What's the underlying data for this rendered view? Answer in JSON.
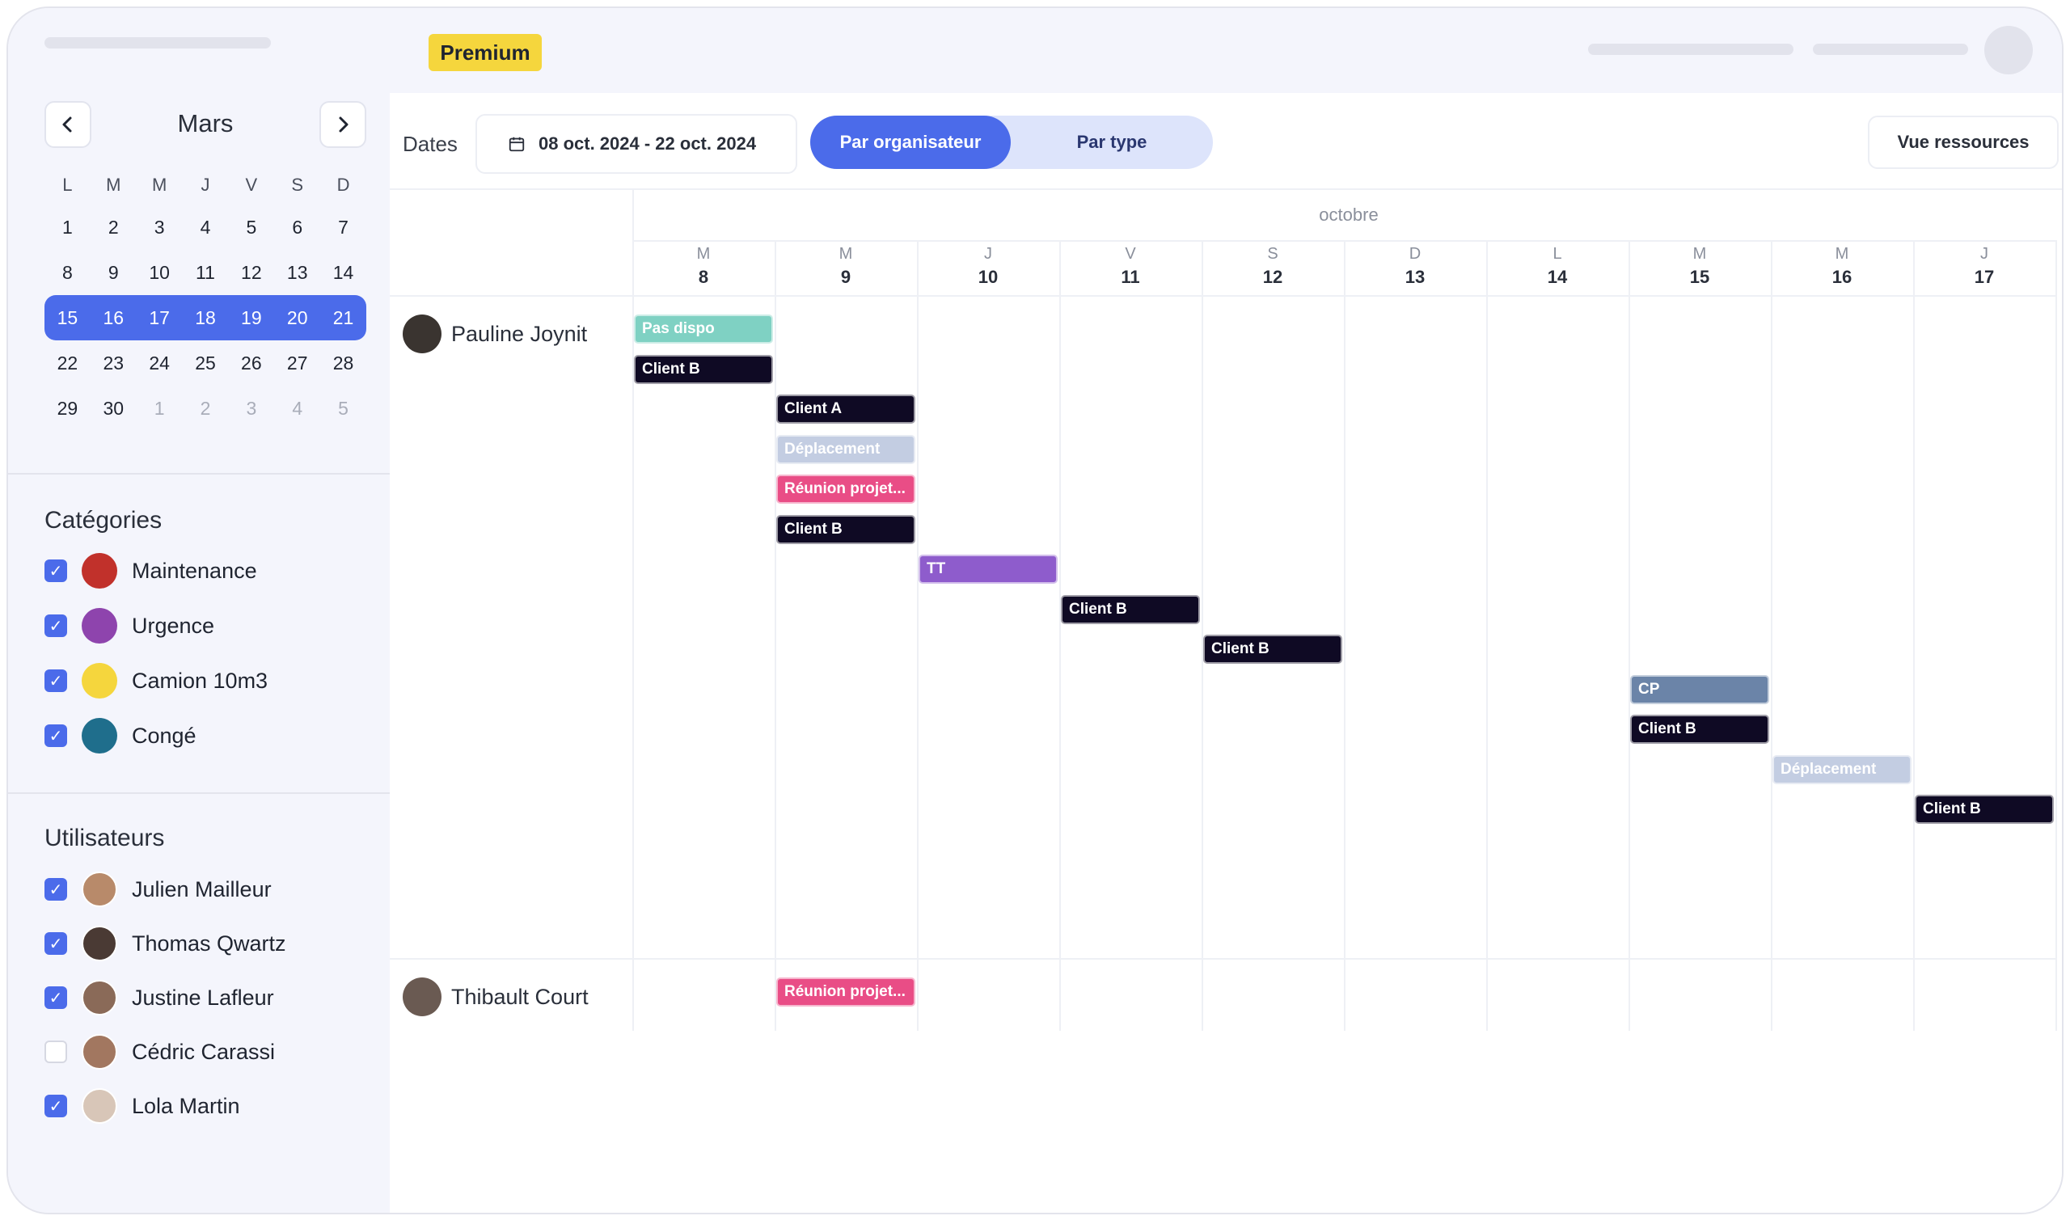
{
  "header": {
    "badge": "Premium"
  },
  "calendar": {
    "month": "Mars",
    "prev_icon": "chevron-left-icon",
    "next_icon": "chevron-right-icon",
    "weekdays": [
      "L",
      "M",
      "M",
      "J",
      "V",
      "S",
      "D"
    ],
    "weeks": [
      [
        "1",
        "2",
        "3",
        "4",
        "5",
        "6",
        "7"
      ],
      [
        "8",
        "9",
        "10",
        "11",
        "12",
        "13",
        "14"
      ],
      [
        "15",
        "16",
        "17",
        "18",
        "19",
        "20",
        "21"
      ],
      [
        "22",
        "23",
        "24",
        "25",
        "26",
        "27",
        "28"
      ],
      [
        "29",
        "30",
        "1",
        "2",
        "3",
        "4",
        "5"
      ]
    ],
    "selected_week": 2
  },
  "categories": {
    "title": "Catégories",
    "items": [
      {
        "label": "Maintenance",
        "color": "#c1312b",
        "checked": true
      },
      {
        "label": "Urgence",
        "color": "#8e44ad",
        "checked": true
      },
      {
        "label": "Camion 10m3",
        "color": "#f5d63d",
        "checked": true
      },
      {
        "label": "Congé",
        "color": "#1f6e8c",
        "checked": true
      }
    ]
  },
  "users": {
    "title": "Utilisateurs",
    "items": [
      {
        "label": "Julien Mailleur",
        "checked": true,
        "avatar_color": "#b88a6a"
      },
      {
        "label": "Thomas Qwartz",
        "checked": true,
        "avatar_color": "#4a3a34"
      },
      {
        "label": "Justine Lafleur",
        "checked": true,
        "avatar_color": "#8a6a58"
      },
      {
        "label": "Cédric Carassi",
        "checked": false,
        "avatar_color": "#a27760"
      },
      {
        "label": "Lola Martin",
        "checked": true,
        "avatar_color": "#d8c6b8"
      }
    ]
  },
  "toolbar": {
    "dates_label": "Dates",
    "date_range": "08 oct. 2024 - 22 oct. 2024",
    "seg_active": "Par organisateur",
    "seg_inactive": "Par type",
    "resources_button": "Vue ressources"
  },
  "planner": {
    "month": "octobre",
    "days": [
      {
        "letter": "M",
        "num": "8"
      },
      {
        "letter": "M",
        "num": "9"
      },
      {
        "letter": "J",
        "num": "10"
      },
      {
        "letter": "V",
        "num": "11"
      },
      {
        "letter": "S",
        "num": "12"
      },
      {
        "letter": "D",
        "num": "13"
      },
      {
        "letter": "L",
        "num": "14"
      },
      {
        "letter": "M",
        "num": "15"
      },
      {
        "letter": "M",
        "num": "16"
      },
      {
        "letter": "J",
        "num": "17"
      }
    ],
    "rows": [
      {
        "name": "Pauline Joynit",
        "avatar_color": "#3a3430",
        "events": [
          {
            "label": "Pas dispo",
            "day": 0,
            "span": 1,
            "color": "#7fd1c3"
          },
          {
            "label": "Client B",
            "day": 0,
            "span": 1,
            "color": "#0f0a24"
          },
          {
            "label": "Client A",
            "day": 1,
            "span": 1,
            "color": "#0f0a24"
          },
          {
            "label": "Déplacement",
            "day": 1,
            "span": 1,
            "color": "#c3cde2"
          },
          {
            "label": "Réunion projet...",
            "day": 1,
            "span": 1,
            "color": "#e94d86"
          },
          {
            "label": "Client B",
            "day": 1,
            "span": 1,
            "color": "#0f0a24"
          },
          {
            "label": "TT",
            "day": 2,
            "span": 1,
            "color": "#8e5ccc"
          },
          {
            "label": "Client B",
            "day": 3,
            "span": 1,
            "color": "#0f0a24"
          },
          {
            "label": "Client B",
            "day": 4,
            "span": 1,
            "color": "#0f0a24"
          },
          {
            "label": "CP",
            "day": 7,
            "span": 1,
            "color": "#6b84a8"
          },
          {
            "label": "Client B",
            "day": 7,
            "span": 1,
            "color": "#0f0a24"
          },
          {
            "label": "Déplacement",
            "day": 8,
            "span": 1,
            "color": "#c3cde2"
          },
          {
            "label": "Client B",
            "day": 9,
            "span": 1,
            "color": "#0f0a24"
          }
        ]
      },
      {
        "name": "Thibault Court",
        "avatar_color": "#6a5a52",
        "events": [
          {
            "label": "Réunion projet...",
            "day": 1,
            "span": 1,
            "color": "#e94d86"
          }
        ]
      }
    ]
  }
}
